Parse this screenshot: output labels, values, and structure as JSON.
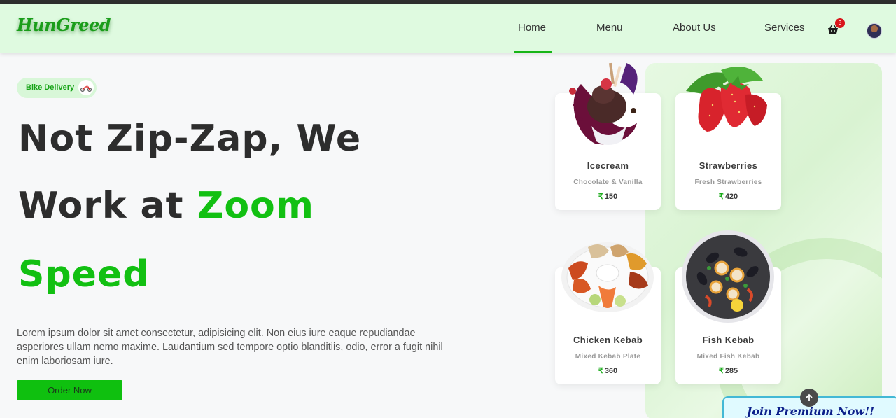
{
  "brand": {
    "logo_text": "HunGreed"
  },
  "nav": {
    "items": [
      {
        "label": "Home",
        "active": true
      },
      {
        "label": "Menu"
      },
      {
        "label": "About Us"
      },
      {
        "label": "Services"
      }
    ],
    "cart_count": "3",
    "cart_icon": "shopping-basket-icon",
    "avatar_icon": "user-avatar"
  },
  "hero": {
    "chip_label": "Bike Delivery",
    "chip_icon": "scooter-icon",
    "line1": "Not Zip-Zap, We",
    "line2_prefix": "Work at ",
    "line2_highlight": "Zoom",
    "line3": "Speed",
    "description": "Lorem ipsum dolor sit amet consectetur, adipisicing elit. Non eius iure eaque repudiandae asperiores ullam nemo maxime. Laudantium sed tempore optio blanditiis, odio, error a fugit nihil enim laboriosam iure.",
    "cta_label": "Order Now"
  },
  "menu_cards": [
    {
      "name": "Icecream",
      "subtitle": "Chocolate & Vanilla",
      "currency": "₹",
      "price": "150"
    },
    {
      "name": "Strawberries",
      "subtitle": "Fresh Strawberries",
      "currency": "₹",
      "price": "420"
    },
    {
      "name": "Chicken Kebab",
      "subtitle": "Mixed Kebab Plate",
      "currency": "₹",
      "price": "360"
    },
    {
      "name": "Fish Kebab",
      "subtitle": "Mixed Fish Kebab",
      "currency": "₹",
      "price": "285"
    }
  ],
  "premium": {
    "label": "Join Premium Now!!",
    "scroll_icon": "arrow-up-icon"
  },
  "colors": {
    "accent": "#12c012",
    "nav_bg": "#dffae0",
    "badge": "#d9151b",
    "premium_text": "#0c1f8a"
  }
}
